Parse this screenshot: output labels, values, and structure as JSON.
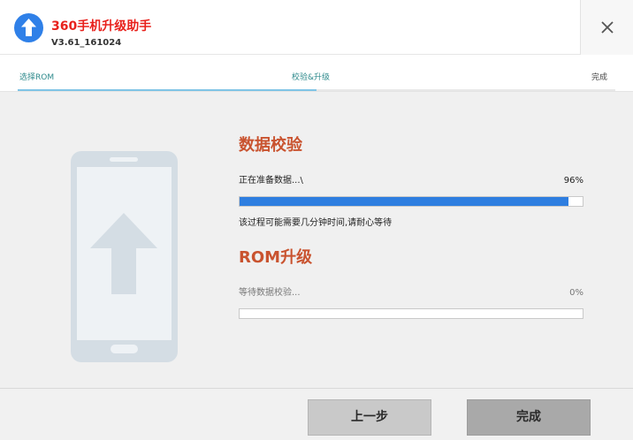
{
  "window": {
    "title": "360手机升级助手",
    "version": "V3.61_161024",
    "close_icon": "close-icon"
  },
  "colors": {
    "accent_blue": "#2f80e8",
    "title_red": "#e8211c",
    "section_orange": "#c9532f",
    "progress_blue": "#2e7ee0",
    "step_active": "#2e8a8c"
  },
  "steps": {
    "items": [
      {
        "label": "选择ROM"
      },
      {
        "label": "校验&升级"
      },
      {
        "label": "完成"
      }
    ],
    "progress_fraction": 0.5
  },
  "illustration": {
    "icon": "phone-upgrade-icon"
  },
  "verify": {
    "title": "数据校验",
    "status": "正在准备数据...\\",
    "percent_label": "96%",
    "progress": 0.96,
    "hint": "该过程可能需要几分钟时间,请耐心等待"
  },
  "upgrade": {
    "title": "ROM升级",
    "status": "等待数据校验...",
    "percent_label": "0%",
    "progress": 0.0
  },
  "footer": {
    "prev_label": "上一步",
    "done_label": "完成"
  }
}
